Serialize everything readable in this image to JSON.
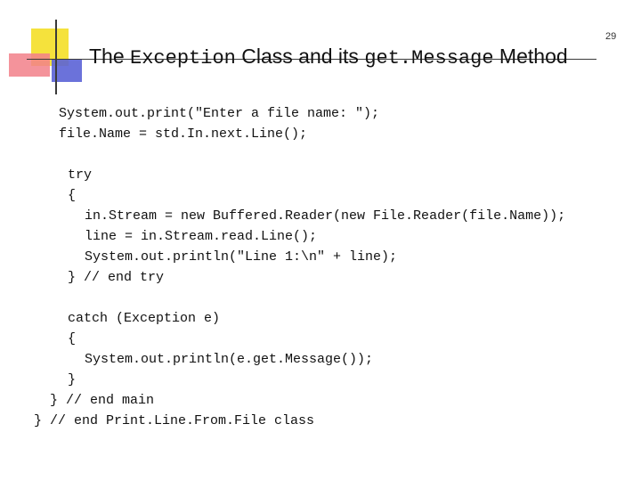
{
  "slide": {
    "page_number": "29",
    "title": {
      "part1": "The ",
      "part2": "Exception",
      "part3": " Class and its ",
      "part4": "get.Message",
      "part5": " Method"
    },
    "code_lines": [
      "System.out.print(\"Enter a file name: \");",
      "file.Name = std.In.next.Line();",
      "try",
      "{",
      "in.Stream = new Buffered.Reader(new File.Reader(file.Name));",
      "line = in.Stream.read.Line();",
      "System.out.println(\"Line 1:\\n\" + line);",
      "} // end try",
      "catch (Exception e)",
      "{",
      "System.out.println(e.get.Message());",
      "}",
      "} // end main",
      "} // end Print.Line.From.File class"
    ]
  }
}
